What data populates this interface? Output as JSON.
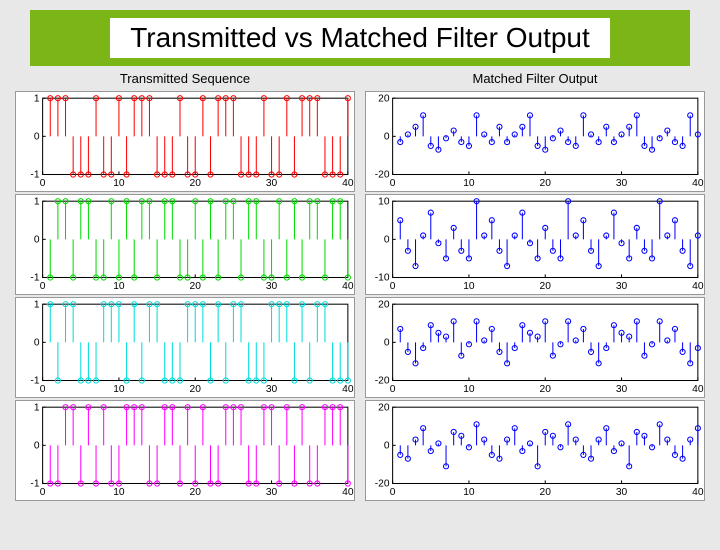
{
  "title": "Transmitted vs Matched Filter Output",
  "col_titles": [
    "Transmitted Sequence",
    "Matched Filter Output"
  ],
  "chart_data": [
    {
      "type": "stem",
      "title": "Transmitted Sequence",
      "color": "#ff0000",
      "xlim": [
        0,
        40
      ],
      "ylim": [
        -1,
        1
      ],
      "xticks": [
        0,
        10,
        20,
        30,
        40
      ],
      "yticks": [
        -1,
        0,
        1
      ],
      "x": [
        1,
        2,
        3,
        4,
        5,
        6,
        7,
        8,
        9,
        10,
        11,
        12,
        13,
        14,
        15,
        16,
        17,
        18,
        19,
        20,
        21,
        22,
        23,
        24,
        25,
        26,
        27,
        28,
        29,
        30,
        31,
        32,
        33,
        34,
        35,
        36,
        37,
        38,
        39,
        40
      ],
      "y": [
        1,
        1,
        1,
        -1,
        -1,
        -1,
        1,
        -1,
        -1,
        1,
        -1,
        1,
        1,
        1,
        -1,
        -1,
        -1,
        1,
        -1,
        -1,
        1,
        -1,
        1,
        1,
        1,
        -1,
        -1,
        -1,
        1,
        -1,
        -1,
        1,
        -1,
        1,
        1,
        1,
        -1,
        -1,
        -1,
        1
      ]
    },
    {
      "type": "stem",
      "title": "Matched Filter Output",
      "color": "#0000ff",
      "xlim": [
        0,
        40
      ],
      "ylim": [
        -20,
        20
      ],
      "xticks": [
        0,
        10,
        20,
        30,
        40
      ],
      "yticks": [
        -20,
        0,
        20
      ],
      "x": [
        1,
        2,
        3,
        4,
        5,
        6,
        7,
        8,
        9,
        10,
        11,
        12,
        13,
        14,
        15,
        16,
        17,
        18,
        19,
        20,
        21,
        22,
        23,
        24,
        25,
        26,
        27,
        28,
        29,
        30,
        31,
        32,
        33,
        34,
        35,
        36,
        37,
        38,
        39,
        40
      ],
      "y": [
        -3,
        1,
        5,
        11,
        -5,
        -7,
        -1,
        3,
        -3,
        -5,
        11,
        1,
        -3,
        5,
        -3,
        1,
        5,
        11,
        -5,
        -7,
        -1,
        3,
        -3,
        -5,
        11,
        1,
        -3,
        5,
        -3,
        1,
        5,
        11,
        -5,
        -7,
        -1,
        3,
        -3,
        -5,
        11,
        1
      ]
    },
    {
      "type": "stem",
      "color": "#00dd00",
      "xlim": [
        0,
        40
      ],
      "ylim": [
        -1,
        1
      ],
      "xticks": [
        0,
        10,
        20,
        30,
        40
      ],
      "yticks": [
        -1,
        0,
        1
      ],
      "x": [
        1,
        2,
        3,
        4,
        5,
        6,
        7,
        8,
        9,
        10,
        11,
        12,
        13,
        14,
        15,
        16,
        17,
        18,
        19,
        20,
        21,
        22,
        23,
        24,
        25,
        26,
        27,
        28,
        29,
        30,
        31,
        32,
        33,
        34,
        35,
        36,
        37,
        38,
        39,
        40
      ],
      "y": [
        -1,
        1,
        1,
        -1,
        1,
        1,
        -1,
        -1,
        1,
        -1,
        1,
        -1,
        1,
        1,
        -1,
        1,
        1,
        -1,
        -1,
        1,
        -1,
        1,
        -1,
        1,
        1,
        -1,
        1,
        1,
        -1,
        -1,
        1,
        -1,
        1,
        -1,
        1,
        1,
        -1,
        1,
        1,
        -1
      ]
    },
    {
      "type": "stem",
      "color": "#0000ff",
      "xlim": [
        0,
        40
      ],
      "ylim": [
        -10,
        10
      ],
      "xticks": [
        0,
        10,
        20,
        30,
        40
      ],
      "yticks": [
        -10,
        0,
        10
      ],
      "x": [
        1,
        2,
        3,
        4,
        5,
        6,
        7,
        8,
        9,
        10,
        11,
        12,
        13,
        14,
        15,
        16,
        17,
        18,
        19,
        20,
        21,
        22,
        23,
        24,
        25,
        26,
        27,
        28,
        29,
        30,
        31,
        32,
        33,
        34,
        35,
        36,
        37,
        38,
        39,
        40
      ],
      "y": [
        5,
        -3,
        -7,
        1,
        7,
        -1,
        -5,
        3,
        -3,
        -5,
        10,
        1,
        5,
        -3,
        -7,
        1,
        7,
        -1,
        -5,
        3,
        -3,
        -5,
        10,
        1,
        5,
        -3,
        -7,
        1,
        7,
        -1,
        -5,
        3,
        -3,
        -5,
        10,
        1,
        5,
        -3,
        -7,
        1
      ]
    },
    {
      "type": "stem",
      "color": "#00dddd",
      "xlim": [
        0,
        40
      ],
      "ylim": [
        -1,
        1
      ],
      "xticks": [
        0,
        10,
        20,
        30,
        40
      ],
      "yticks": [
        -1,
        0,
        1
      ],
      "x": [
        1,
        2,
        3,
        4,
        5,
        6,
        7,
        8,
        9,
        10,
        11,
        12,
        13,
        14,
        15,
        16,
        17,
        18,
        19,
        20,
        21,
        22,
        23,
        24,
        25,
        26,
        27,
        28,
        29,
        30,
        31,
        32,
        33,
        34,
        35,
        36,
        37,
        38,
        39,
        40
      ],
      "y": [
        1,
        -1,
        1,
        1,
        -1,
        -1,
        -1,
        1,
        1,
        1,
        -1,
        1,
        -1,
        1,
        1,
        -1,
        -1,
        -1,
        1,
        1,
        1,
        -1,
        1,
        -1,
        1,
        1,
        -1,
        -1,
        -1,
        1,
        1,
        1,
        -1,
        1,
        -1,
        1,
        1,
        -1,
        -1,
        -1
      ]
    },
    {
      "type": "stem",
      "color": "#0000ff",
      "xlim": [
        0,
        40
      ],
      "ylim": [
        -20,
        20
      ],
      "xticks": [
        0,
        10,
        20,
        30,
        40
      ],
      "yticks": [
        -20,
        0,
        20
      ],
      "x": [
        1,
        2,
        3,
        4,
        5,
        6,
        7,
        8,
        9,
        10,
        11,
        12,
        13,
        14,
        15,
        16,
        17,
        18,
        19,
        20,
        21,
        22,
        23,
        24,
        25,
        26,
        27,
        28,
        29,
        30,
        31,
        32,
        33,
        34,
        35,
        36,
        37,
        38,
        39,
        40
      ],
      "y": [
        7,
        -5,
        -11,
        -3,
        9,
        5,
        3,
        11,
        -7,
        -1,
        11,
        1,
        7,
        -5,
        -11,
        -3,
        9,
        5,
        3,
        11,
        -7,
        -1,
        11,
        1,
        7,
        -5,
        -11,
        -3,
        9,
        5,
        3,
        11,
        -7,
        -1,
        11,
        1,
        7,
        -5,
        -11,
        -3
      ]
    },
    {
      "type": "stem",
      "color": "#ff00ff",
      "xlim": [
        0,
        40
      ],
      "ylim": [
        -1,
        1
      ],
      "xticks": [
        0,
        10,
        20,
        30,
        40
      ],
      "yticks": [
        -1,
        0,
        1
      ],
      "x": [
        1,
        2,
        3,
        4,
        5,
        6,
        7,
        8,
        9,
        10,
        11,
        12,
        13,
        14,
        15,
        16,
        17,
        18,
        19,
        20,
        21,
        22,
        23,
        24,
        25,
        26,
        27,
        28,
        29,
        30,
        31,
        32,
        33,
        34,
        35,
        36,
        37,
        38,
        39,
        40
      ],
      "y": [
        -1,
        -1,
        1,
        1,
        -1,
        1,
        -1,
        1,
        -1,
        -1,
        1,
        1,
        1,
        -1,
        -1,
        1,
        1,
        -1,
        1,
        -1,
        1,
        -1,
        -1,
        1,
        1,
        1,
        -1,
        -1,
        1,
        1,
        -1,
        1,
        -1,
        1,
        -1,
        -1,
        1,
        1,
        1,
        -1
      ]
    },
    {
      "type": "stem",
      "color": "#0000ff",
      "xlim": [
        0,
        40
      ],
      "ylim": [
        -20,
        20
      ],
      "xticks": [
        0,
        10,
        20,
        30,
        40
      ],
      "yticks": [
        -20,
        0,
        20
      ],
      "x": [
        1,
        2,
        3,
        4,
        5,
        6,
        7,
        8,
        9,
        10,
        11,
        12,
        13,
        14,
        15,
        16,
        17,
        18,
        19,
        20,
        21,
        22,
        23,
        24,
        25,
        26,
        27,
        28,
        29,
        30,
        31,
        32,
        33,
        34,
        35,
        36,
        37,
        38,
        39,
        40
      ],
      "y": [
        -5,
        -7,
        3,
        9,
        -3,
        1,
        -11,
        7,
        5,
        -1,
        11,
        3,
        -5,
        -7,
        3,
        9,
        -3,
        1,
        -11,
        7,
        5,
        -1,
        11,
        3,
        -5,
        -7,
        3,
        9,
        -3,
        1,
        -11,
        7,
        5,
        -1,
        11,
        3,
        -5,
        -7,
        3,
        9
      ]
    }
  ]
}
